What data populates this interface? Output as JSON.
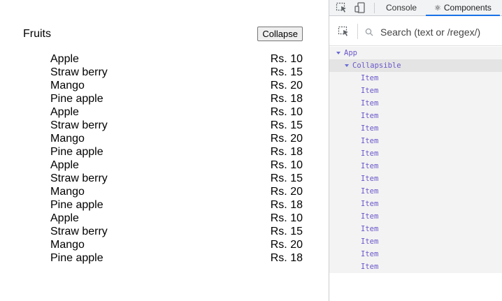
{
  "app": {
    "title": "Fruits",
    "collapse_label": "Collapse",
    "items": [
      {
        "name": "Apple",
        "price": "Rs. 10"
      },
      {
        "name": "Straw berry",
        "price": "Rs. 15"
      },
      {
        "name": "Mango",
        "price": "Rs. 20"
      },
      {
        "name": "Pine apple",
        "price": "Rs. 18"
      },
      {
        "name": "Apple",
        "price": "Rs. 10"
      },
      {
        "name": "Straw berry",
        "price": "Rs. 15"
      },
      {
        "name": "Mango",
        "price": "Rs. 20"
      },
      {
        "name": "Pine apple",
        "price": "Rs. 18"
      },
      {
        "name": "Apple",
        "price": "Rs. 10"
      },
      {
        "name": "Straw berry",
        "price": "Rs. 15"
      },
      {
        "name": "Mango",
        "price": "Rs. 20"
      },
      {
        "name": "Pine apple",
        "price": "Rs. 18"
      },
      {
        "name": "Apple",
        "price": "Rs. 10"
      },
      {
        "name": "Straw berry",
        "price": "Rs. 15"
      },
      {
        "name": "Mango",
        "price": "Rs. 20"
      },
      {
        "name": "Pine apple",
        "price": "Rs. 18"
      }
    ]
  },
  "devtools": {
    "tabs": [
      {
        "label": "Console",
        "active": false
      },
      {
        "label": "Components",
        "active": true,
        "icon": "react-icon"
      }
    ],
    "search_placeholder": "Search (text or /regex/)",
    "tree": {
      "root": "App",
      "child": "Collapsible",
      "items": [
        "Item",
        "Item",
        "Item",
        "Item",
        "Item",
        "Item",
        "Item",
        "Item",
        "Item",
        "Item",
        "Item",
        "Item",
        "Item",
        "Item",
        "Item",
        "Item"
      ]
    },
    "colors": {
      "accent": "#1a73e8",
      "component": "#6b57c9"
    }
  }
}
